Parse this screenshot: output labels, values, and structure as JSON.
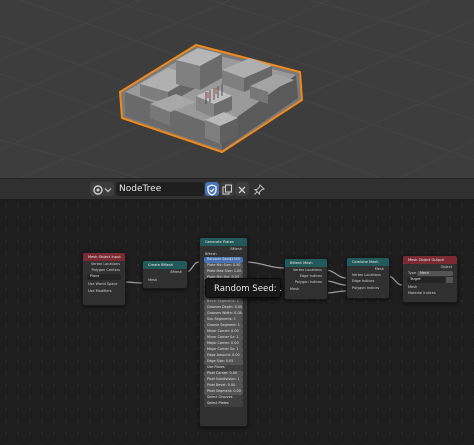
{
  "node_tree": {
    "name": "NodeTree",
    "icons": [
      "node-tree-icon",
      "chevron-down-icon",
      "fake-user-shield-icon",
      "duplicate-icon",
      "close-icon",
      "pin-icon"
    ]
  },
  "nodes": {
    "mesh_object_input": {
      "title": "Mesh Object Input",
      "outputs": [
        "Vertex Locations",
        "Polygon Centers"
      ],
      "object": "Plane",
      "toggles": [
        "Use World Space",
        "Use Modifiers"
      ]
    },
    "create_bmesh": {
      "title": "Create BMesh",
      "output": "BMesh",
      "input": "Mesh"
    },
    "generate_plates": {
      "title": "Generate Plates",
      "output": "BMesh",
      "input": "BMesh",
      "seed_label": "Random Seed",
      "seed_value": "12345",
      "params": [
        "Plate Min Size: 0.50",
        "Plate Max Size: 1.00",
        "Plate Min Hei: 0.05",
        "Plate Max Hei: 0.20",
        "Plate Height: 0.1145",
        "Bevel Amount: 0.05",
        "Bevel Segments: 1",
        "Grooves Depth: 0.00",
        "Grooves Width: 0.08",
        "Sub Segments: 1",
        "Groove Segment: 1",
        "Minor Corner: 0.00",
        "Minor Corner Sz: 1",
        "Major Corner: 0.00",
        "Major Corner Sz: 1",
        "Edge Amount: 0.00",
        "Edge Size: 0.05"
      ],
      "uv_label": "Use Plates",
      "tail_params": [
        "Pixel Corner: 0.00",
        "Pixel Subdivision: 1",
        "Pixel Bevel: 0.00",
        "Pixel Segment: 0.00"
      ],
      "selects": [
        "Select Grooves",
        "Select Plates"
      ]
    },
    "bmesh_mesh": {
      "title": "BMesh Mesh",
      "input": "BMesh",
      "outputs": [
        "Vertex Locations",
        "Edge Indices",
        "Polygon Indices",
        "Mesh"
      ]
    },
    "combine_mesh": {
      "title": "Combine Mesh",
      "output": "Mesh",
      "inputs": [
        "Vertex Locations",
        "Edge Indices",
        "Polygon Indices"
      ]
    },
    "mesh_object_output": {
      "title": "Mesh Object Output",
      "output": "Object",
      "type_label": "Type",
      "type_value": "Mesh",
      "target": "Target",
      "inputs": [
        "Mesh",
        "Material Indices"
      ]
    }
  },
  "tooltip": {
    "text": "Random Seed: ."
  }
}
